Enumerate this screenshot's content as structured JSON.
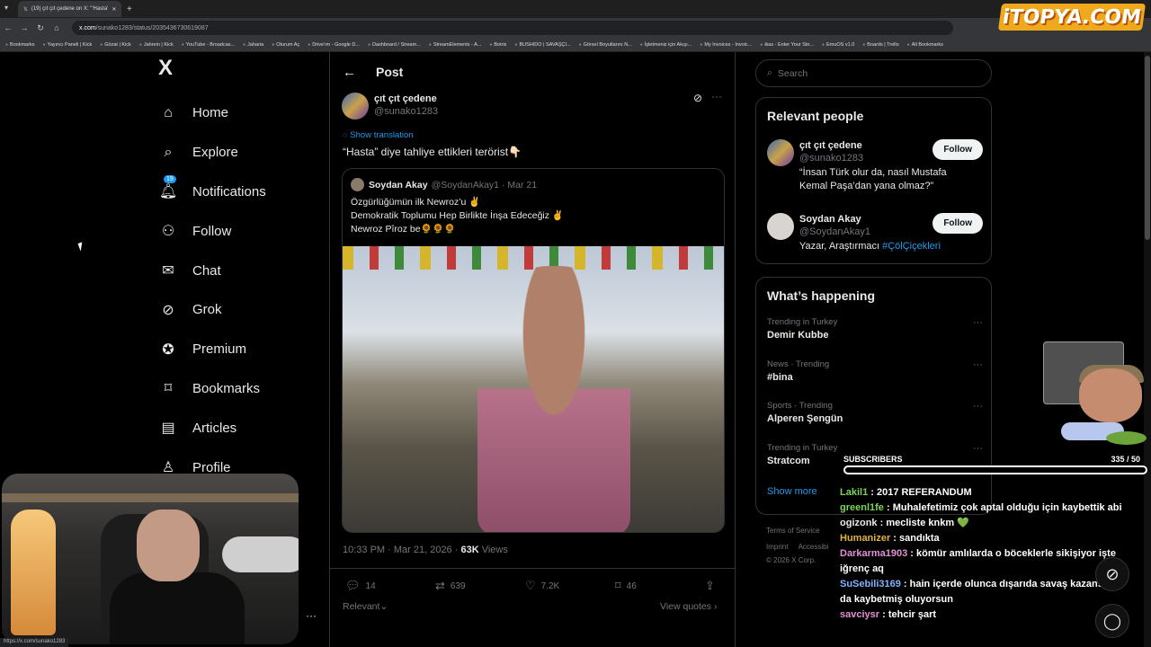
{
  "browser": {
    "tab_title": "(19) çıt çıt çedene on X: \"'Hasta'",
    "url_domain": "x.com",
    "url_path": "/sunako1283/status/2035436730619087",
    "bookmarks": [
      "Bookmarks",
      "Yayıncı Paneli | Kick",
      "Gözat | Kick",
      "Jahrein | Kick",
      "YouTube - Broadcas...",
      "Jaharia",
      "Oturum Aç",
      "Drive'ım - Google D...",
      "Dashboard / Stream...",
      "StreamElements - A...",
      "Botrix",
      "BUSHIDO | SAVAŞÇI...",
      "Görsel Boyutlarını N...",
      "İşletmeniz için Akışı...",
      "My Invoices - Invoic...",
      "ikas - Enter Your Sto...",
      "EmuOS v1.0",
      "Boards | Trello",
      "All Bookmarks"
    ],
    "status_url": "https://x.com/sunako1283"
  },
  "overlay": {
    "logo": "iTOPYA.COM"
  },
  "sidebar": {
    "logo": "X",
    "items": [
      {
        "label": "Home",
        "icon": "home-icon"
      },
      {
        "label": "Explore",
        "icon": "search-icon"
      },
      {
        "label": "Notifications",
        "icon": "bell-icon",
        "badge": "19"
      },
      {
        "label": "Follow",
        "icon": "add-user-icon"
      },
      {
        "label": "Chat",
        "icon": "mail-icon"
      },
      {
        "label": "Grok",
        "icon": "grok-icon"
      },
      {
        "label": "Premium",
        "icon": "verified-icon"
      },
      {
        "label": "Bookmarks",
        "icon": "bookmark-icon"
      },
      {
        "label": "Articles",
        "icon": "article-icon"
      },
      {
        "label": "Profile",
        "icon": "profile-icon"
      }
    ]
  },
  "post": {
    "header": "Post",
    "author_name": "çıt çıt çedene",
    "author_handle": "@sunako1283",
    "show_translation": "Show translation",
    "text": "“Hasta” diye tahliye ettikleri terörist👇🏻",
    "quote": {
      "name": "Soydan Akay",
      "handle": "@SoydanAkay1",
      "date": "· Mar 21",
      "text": "Özgürlüğümün ilk Newroz’u ✌️\nDemokratik Toplumu Hep Birlikte İnşa Edeceğiz ✌️\nNewroz Pîroz be🌻🌻🌻"
    },
    "time": "10:33 PM · Mar 21, 2026 · ",
    "views_count": "63K",
    "views_label": " Views",
    "replies": "14",
    "reposts": "639",
    "likes": "7.2K",
    "bookmarks": "46",
    "sort": "Relevant",
    "view_quotes": "View quotes"
  },
  "right": {
    "search_placeholder": "Search",
    "relevant_title": "Relevant people",
    "people": [
      {
        "name": "çıt çıt çedene",
        "handle": "@sunako1283",
        "bio": "“İnsan Türk olur da, nasıl Mustafa Kemal Paşa’dan yana olmaz?”",
        "bio_link": "",
        "button": "Follow"
      },
      {
        "name": "Soydan Akay",
        "handle": "@SoydanAkay1",
        "bio": "Yazar, Araştırmacı ",
        "bio_link": "#ÇölÇiçekleri",
        "button": "Follow"
      }
    ],
    "happening_title": "What’s happening",
    "trends": [
      {
        "cat": "Trending in Turkey",
        "name": "Demir Kubbe"
      },
      {
        "cat": "News · Trending",
        "name": "#bina"
      },
      {
        "cat": "Sports · Trending",
        "name": "Alperen Şengün"
      },
      {
        "cat": "Trending in Turkey",
        "name": "Stratcom"
      }
    ],
    "show_more": "Show more",
    "footer1": "Terms of Service",
    "footer2": "Imprint",
    "footer2b": "Accessibi",
    "footer3": "© 2026 X Corp."
  },
  "stream": {
    "subs_label": "SUBSCRIBERS",
    "subs_count": "335 / 50",
    "chat": [
      {
        "user": "Lakil1",
        "color": "#7dd35a",
        "text": " : 2017 REFERANDUM"
      },
      {
        "user": "greenl1fe",
        "color": "#7dd35a",
        "text": " : Muhalefetimiz çok aptal olduğu için kaybettik abi"
      },
      {
        "user": "ogizonk",
        "color": "#e7e9ea",
        "text": " : mecliste knkm 💚"
      },
      {
        "user": "Humanizer",
        "color": "#e0b43a",
        "text": " : sandıkta"
      },
      {
        "user": "Darkarma1903",
        "color": "#e38fd6",
        "text": " : kömür amlılarda o böceklerle sikişiyor işte iğrenç aq"
      },
      {
        "user": "SuSebili3169",
        "color": "#7fb2ff",
        "text": " : hain içerde olunca dışarıda savaş kazansan da kaybetmiş oluyorsun"
      },
      {
        "user": "savciysr",
        "color": "#e38fd6",
        "text": " : tehcir şart"
      }
    ]
  }
}
